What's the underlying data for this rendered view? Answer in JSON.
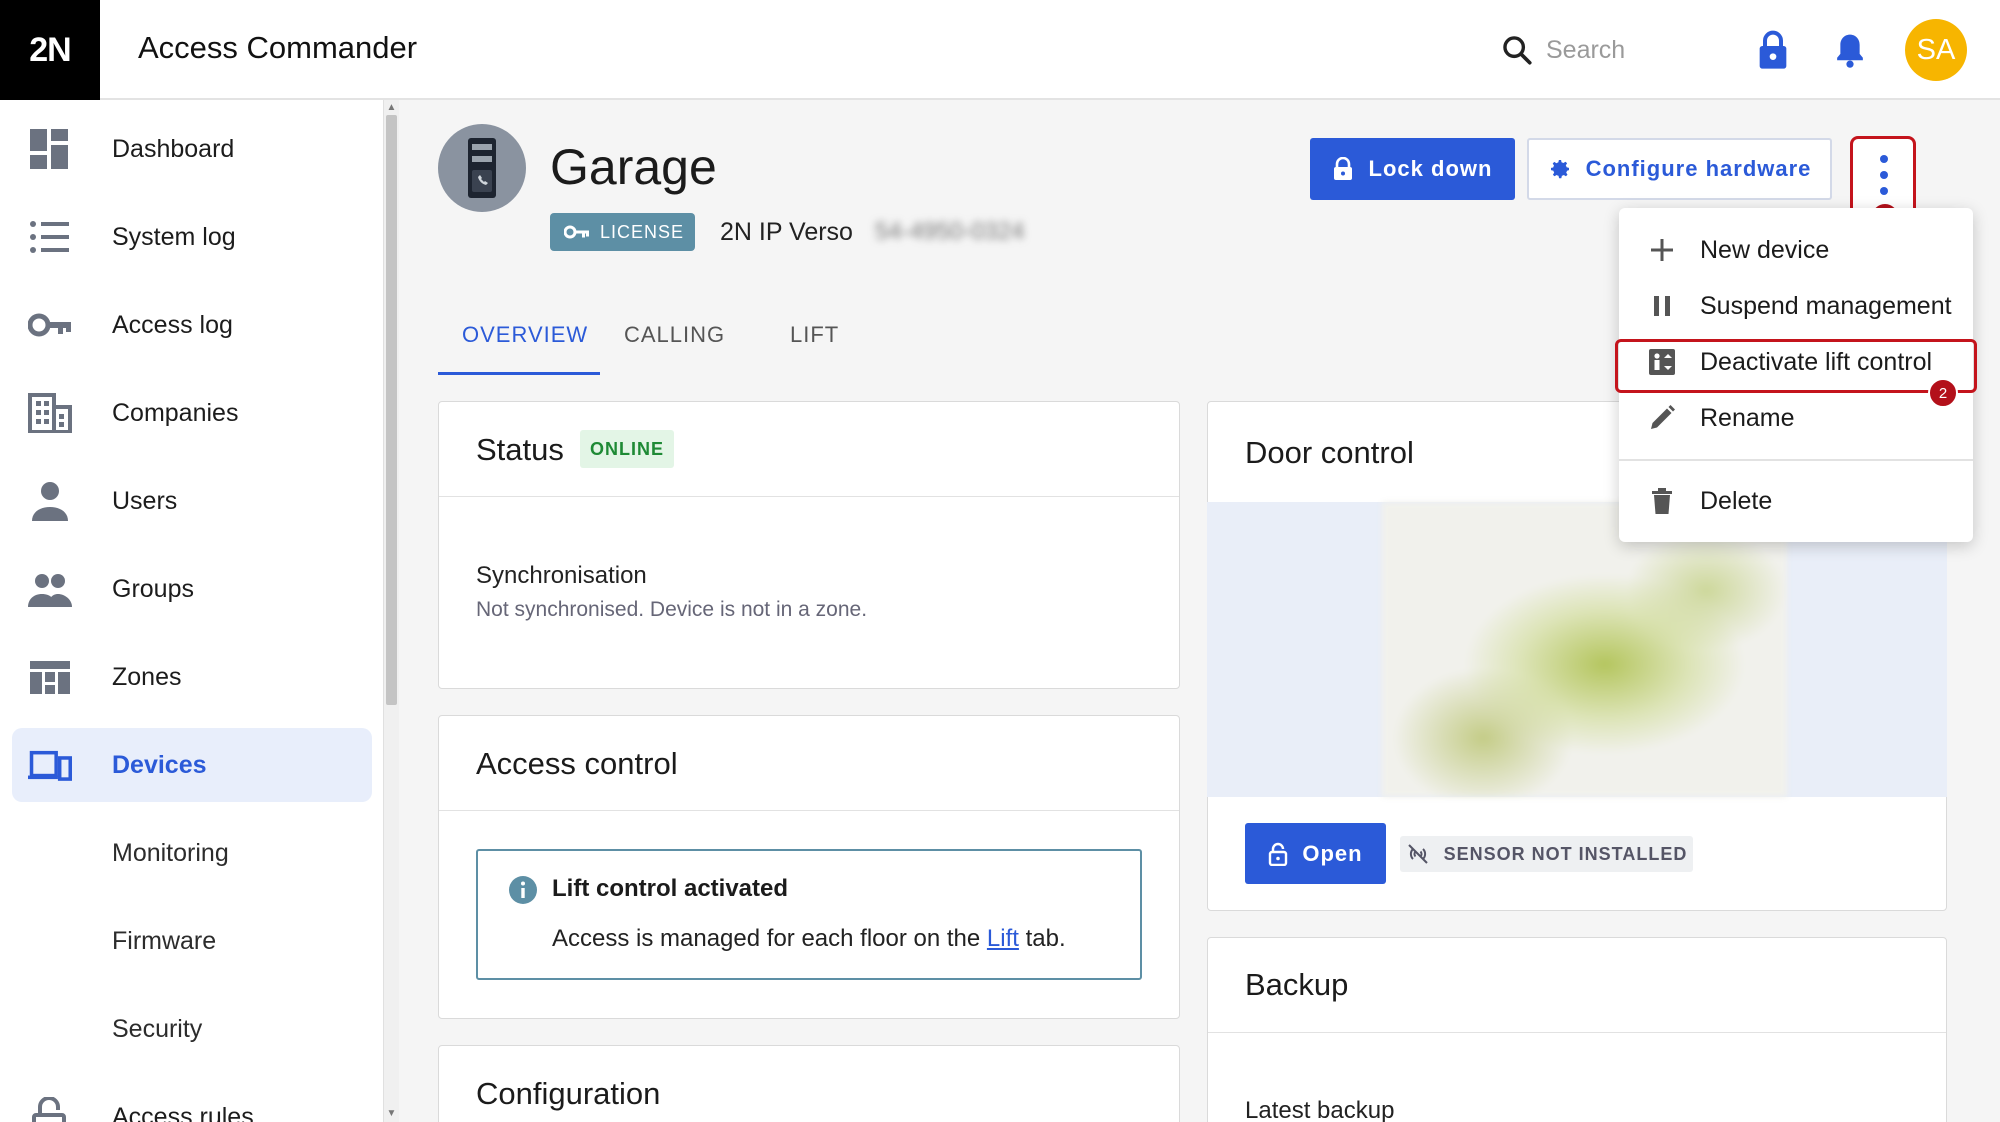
{
  "app": {
    "logo": "2N",
    "title": "Access Commander",
    "search_placeholder": "Search",
    "avatar_initials": "SA"
  },
  "sidebar": {
    "items": [
      {
        "label": "Dashboard",
        "icon": "dashboard-icon"
      },
      {
        "label": "System log",
        "icon": "list-icon"
      },
      {
        "label": "Access log",
        "icon": "key-icon"
      },
      {
        "label": "Companies",
        "icon": "building-icon"
      },
      {
        "label": "Users",
        "icon": "user-icon"
      },
      {
        "label": "Groups",
        "icon": "group-icon"
      },
      {
        "label": "Zones",
        "icon": "zones-icon"
      },
      {
        "label": "Devices",
        "icon": "devices-icon",
        "active": true
      },
      {
        "label": "Monitoring"
      },
      {
        "label": "Firmware"
      },
      {
        "label": "Security"
      },
      {
        "label": "Access rules",
        "icon": "lock-open-icon"
      }
    ]
  },
  "device": {
    "name": "Garage",
    "license_label": "LICENSE",
    "model": "2N IP Verso",
    "serial": "54-4950-0324"
  },
  "actions": {
    "lockdown_label": "Lock down",
    "configure_label": "Configure hardware",
    "callout_1": "1",
    "callout_2": "2"
  },
  "tabs": [
    {
      "label": "OVERVIEW",
      "active": true
    },
    {
      "label": "CALLING"
    },
    {
      "label": "LIFT"
    }
  ],
  "status_card": {
    "title": "Status",
    "badge": "ONLINE",
    "sync_label": "Synchronisation",
    "sync_desc": "Not synchronised. Device is not in a zone."
  },
  "access_card": {
    "title": "Access control",
    "info_title": "Lift control activated",
    "info_text_before": "Access is managed for each floor on the ",
    "info_link": "Lift",
    "info_text_after": " tab."
  },
  "config_card": {
    "title": "Configuration"
  },
  "door_card": {
    "title": "Door control",
    "open_label": "Open",
    "sensor_label": "SENSOR NOT INSTALLED"
  },
  "backup_card": {
    "title": "Backup",
    "latest_label": "Latest backup"
  },
  "menu": {
    "items": [
      {
        "label": "New device",
        "icon": "plus-icon"
      },
      {
        "label": "Suspend management",
        "icon": "pause-icon"
      },
      {
        "label": "Deactivate lift control",
        "icon": "lift-icon"
      },
      {
        "label": "Rename",
        "icon": "pencil-icon"
      },
      {
        "label": "Delete",
        "icon": "trash-icon"
      }
    ]
  },
  "colors": {
    "primary": "#2b5ad8",
    "highlight": "#c4141c",
    "avatar": "#f7b500",
    "online": "#1e8a35",
    "license": "#5d8fa5"
  }
}
